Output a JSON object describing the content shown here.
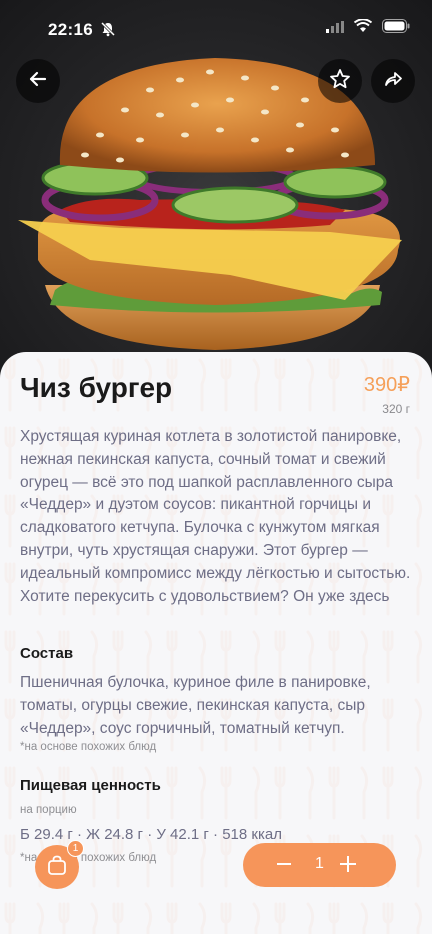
{
  "status": {
    "time": "22:16"
  },
  "product": {
    "title": "Чиз бургер",
    "price": "390₽",
    "weight": "320 г",
    "description": "Хрустящая куриная котлета в золотистой панировке, нежная пекинская капуста, сочный томат и свежий огурец — всё это под шапкой расплавленного сыра «Чеддер» и дуэтом соусов: пикантной горчицы и сладковатого кетчупа. Булочка с кунжутом мягкая внутри, чуть хрустящая снаружи. Этот бургер — идеальный компромисс между лёгкостью и сытостью. Хотите перекусить с удовольствием? Он уже здесь"
  },
  "composition": {
    "heading": "Состав",
    "text": "Пшеничная булочка, куриное филе в панировке, томаты, огурцы свежие, пекинская капуста, сыр «Чеддер», соус горчичный, томатный кетчуп.",
    "note": "*на основе похожих блюд"
  },
  "nutrition": {
    "heading": "Пищевая ценность",
    "per": "на порцию",
    "values": "Б 29.4 г · Ж 24.8 г · У 42.1 г · 518 ккал",
    "note": "*на основе похожих блюд"
  },
  "cart": {
    "count": "1"
  },
  "quantity": {
    "value": "1"
  },
  "colors": {
    "accent": "#f6955a",
    "price": "#f5a05a",
    "text_muted": "#6e6e86"
  },
  "icons": [
    "back-arrow-icon",
    "star-icon",
    "share-icon",
    "bag-icon",
    "minus-icon",
    "plus-icon",
    "bell-slash-icon",
    "signal-icon",
    "wifi-icon",
    "battery-icon"
  ]
}
